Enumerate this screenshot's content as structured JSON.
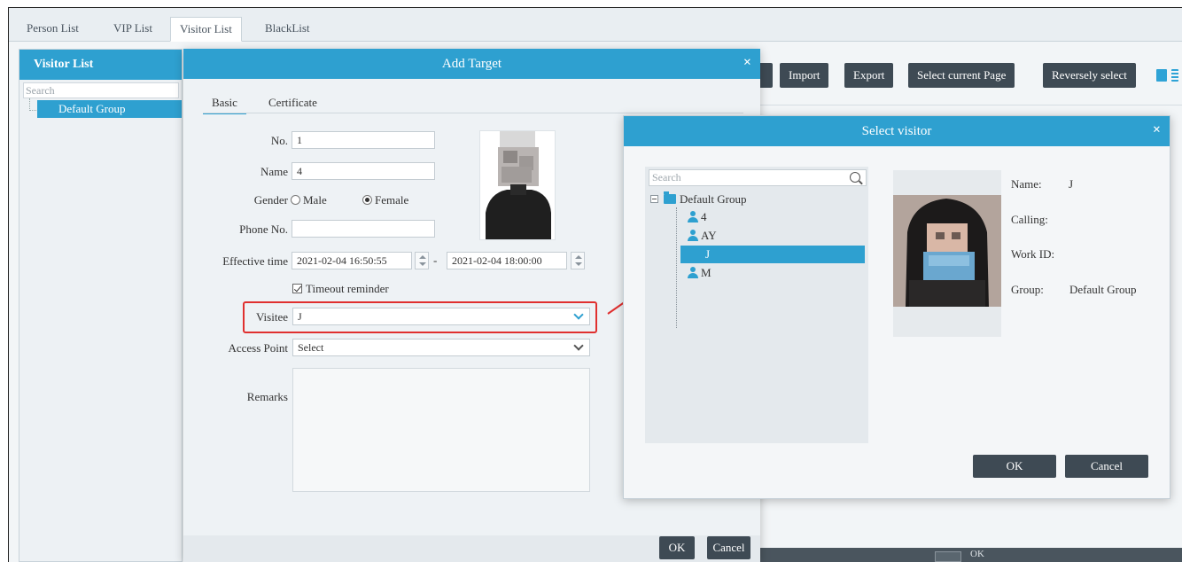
{
  "top_tabs": [
    "Person List",
    "VIP List",
    "Visitor List",
    "BlackList"
  ],
  "active_top_tab": "Visitor List",
  "toolbar": {
    "import": "Import",
    "export": "Export",
    "select_current_page": "Select current Page",
    "reversely_select": "Reversely select"
  },
  "left_panel": {
    "title": "Visitor List",
    "search_placeholder": "Search",
    "group": "Default Group"
  },
  "add_target": {
    "title": "Add Target",
    "tabs": [
      "Basic",
      "Certificate"
    ],
    "fields": {
      "no_label": "No.",
      "no_value": "1",
      "name_label": "Name",
      "name_value": "4",
      "gender_label": "Gender",
      "gender_male": "Male",
      "gender_female": "Female",
      "gender_selected": "Female",
      "phone_label": "Phone No.",
      "phone_value": "",
      "effective_label": "Effective time",
      "effective_start": "2021-02-04 16:50:55",
      "effective_separator": "-",
      "effective_end": "2021-02-04 18:00:00",
      "timeout_reminder": "Timeout reminder",
      "visitee_label": "Visitee",
      "visitee_value": "J",
      "access_point_label": "Access Point",
      "access_point_value": "Select",
      "remarks_label": "Remarks"
    },
    "ok": "OK",
    "cancel": "Cancel"
  },
  "select_visitor": {
    "title": "Select visitor",
    "search_placeholder": "Search",
    "tree": {
      "group": "Default Group",
      "members": [
        "4",
        "AY",
        "J",
        "M"
      ],
      "selected": "J"
    },
    "info": {
      "name_label": "Name:",
      "name_value": "J",
      "calling_label": "Calling:",
      "work_id_label": "Work ID:",
      "group_label": "Group:",
      "group_value": "Default Group"
    },
    "ok": "OK",
    "cancel": "Cancel"
  },
  "colors": {
    "accent": "#2ea0d0",
    "dark_button": "#3e4a54",
    "highlight": "#e0302f"
  }
}
